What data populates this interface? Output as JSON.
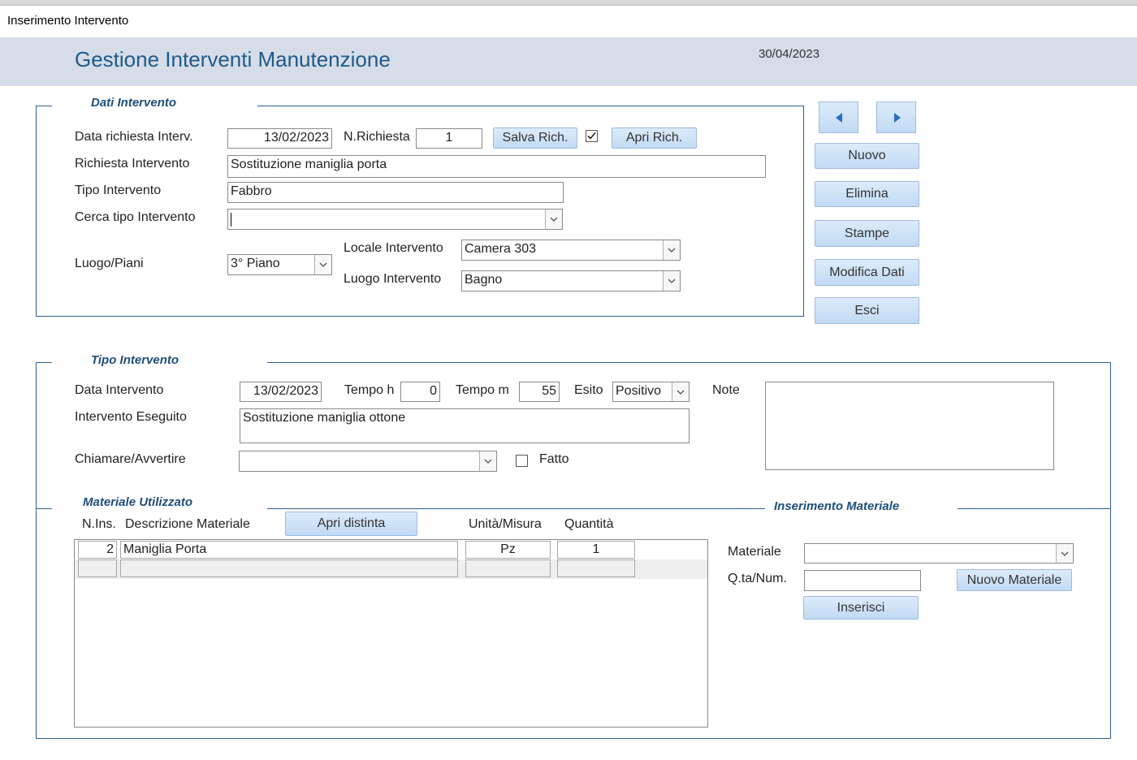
{
  "window": {
    "title": "Inserimento Intervento"
  },
  "header": {
    "title": "Gestione Interventi Manutenzione",
    "date": "30/04/2023"
  },
  "dati": {
    "legend": "Dati Intervento",
    "data_richiesta_label": "Data richiesta Interv.",
    "data_richiesta_value": "13/02/2023",
    "n_richiesta_label": "N.Richiesta",
    "n_richiesta_value": "1",
    "salva_label": "Salva Rich.",
    "apri_label": "Apri Rich.",
    "richiesta_label": "Richiesta Intervento",
    "richiesta_value": "Sostituzione maniglia porta",
    "tipo_label": "Tipo Intervento",
    "tipo_value": "Fabbro",
    "cerca_label": "Cerca tipo Intervento",
    "cerca_value": "",
    "luogo_piani_label": "Luogo/Piani",
    "luogo_piani_value": "3° Piano",
    "locale_label": "Locale Intervento",
    "locale_value": "Camera 303",
    "luogo_label": "Luogo Intervento",
    "luogo_value": "Bagno"
  },
  "side_buttons": {
    "nuovo": "Nuovo",
    "elimina": "Elimina",
    "stampe": "Stampe",
    "modifica": "Modifica Dati",
    "esci": "Esci"
  },
  "tipo": {
    "legend": "Tipo Intervento",
    "data_label": "Data Intervento",
    "data_value": "13/02/2023",
    "tempo_h_label": "Tempo h",
    "tempo_h_value": "0",
    "tempo_m_label": "Tempo m",
    "tempo_m_value": "55",
    "esito_label": "Esito",
    "esito_value": "Positivo",
    "note_label": "Note",
    "note_value": "",
    "eseguito_label": "Intervento Eseguito",
    "eseguito_value": "Sostituzione maniglia ottone",
    "chiamare_label": "Chiamare/Avvertire",
    "chiamare_value": "",
    "fatto_label": "Fatto"
  },
  "materiale": {
    "legend": "Materiale Utilizzato",
    "col_nins": "N.Ins.",
    "col_descr": "Descrizione Materiale",
    "apri_distinta": "Apri distinta",
    "col_unita": "Unità/Misura",
    "col_quantita": "Quantità",
    "rows": [
      {
        "nins": "2",
        "descr": "Maniglia Porta",
        "unita": "Pz",
        "qta": "1"
      }
    ]
  },
  "inserimento": {
    "legend": "Inserimento Materiale",
    "materiale_label": "Materiale",
    "materiale_value": "",
    "qta_label": "Q.ta/Num.",
    "qta_value": "",
    "nuovo_materiale": "Nuovo Materiale",
    "inserisci": "Inserisci"
  },
  "icons": {
    "prev": "triangle-left-icon",
    "next": "triangle-right-icon",
    "dropdown": "chevron-down-icon",
    "check": "checkmark-icon"
  },
  "colors": {
    "header_bg": "#d6dde8",
    "title": "#1f5a8a",
    "legend": "#1f4e79",
    "button": "#c9def5"
  }
}
